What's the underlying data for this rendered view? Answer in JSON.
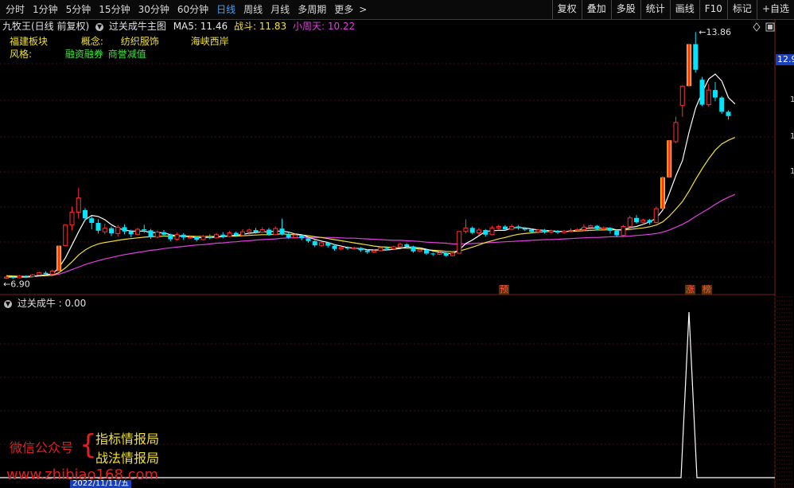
{
  "toolbar": {
    "periods": [
      "分时",
      "1分钟",
      "5分钟",
      "15分钟",
      "30分钟",
      "60分钟",
      "日线",
      "周线",
      "月线",
      "多周期",
      "更多"
    ],
    "active_period": "日线",
    "more_arrow": "chevron-right-icon",
    "tools": [
      "复权",
      "叠加",
      "多股",
      "统计",
      "画线",
      "F10",
      "标记",
      "+自选"
    ]
  },
  "header": {
    "stock": "九牧王(日线 前复权)",
    "indicator": "过关成牛主图",
    "ma5": "MA5: 11.46",
    "zhandou": "战斗: 11.83",
    "xiaozhoutian": "小周天: 10.22"
  },
  "info": {
    "sector": "福建板块",
    "concept_label": "概念:",
    "concept1": "纺织服饰",
    "concept2": "海峡西岸",
    "style_label": "风格:",
    "style1": "融资融券",
    "style2": "商誉减值"
  },
  "icons": {
    "top_diamond": "diamond-icon",
    "top_window": "window-icon"
  },
  "price_labels": {
    "high": "13.86",
    "low": "6.90",
    "side": "12.9"
  },
  "markers": {
    "yu": "预",
    "zhang": "涨",
    "bang": "榜"
  },
  "lower": {
    "title": "过关成牛 : 0.00"
  },
  "watermark": {
    "wechat": "微信公众号",
    "brace": "{",
    "line1": "指标情报局",
    "line2": "战法情报局",
    "url": "www.zhibiao168.com",
    "date_tag": "2022/11/11/五"
  },
  "colors": {
    "up": "#ff3030",
    "down": "#00e5ff",
    "limit_up": "#ffc000",
    "ma5": "#ffffff",
    "zhandou": "#f0e030",
    "xzt": "#e040e0",
    "active_tab": "#3fa3ff"
  },
  "chart_data": {
    "type": "candlestick",
    "price_range": [
      6.6,
      14.2
    ],
    "high": 13.86,
    "low": 6.9,
    "candles": [
      [
        6.95,
        6.98,
        7.02,
        6.92
      ],
      [
        6.98,
        6.96,
        7.0,
        6.93
      ],
      [
        6.96,
        7.01,
        7.04,
        6.94
      ],
      [
        7.01,
        6.99,
        7.03,
        6.96
      ],
      [
        6.99,
        7.04,
        7.07,
        6.97
      ],
      [
        7.04,
        7.1,
        7.13,
        7.02
      ],
      [
        7.1,
        7.06,
        7.14,
        7.03
      ],
      [
        7.06,
        7.15,
        7.19,
        7.04
      ],
      [
        7.15,
        7.86,
        7.86,
        7.15
      ],
      [
        7.86,
        8.44,
        8.46,
        7.84
      ],
      [
        8.44,
        8.8,
        8.96,
        8.3
      ],
      [
        8.8,
        9.2,
        9.48,
        8.62
      ],
      [
        8.86,
        8.63,
        8.92,
        8.55
      ],
      [
        8.63,
        8.5,
        8.7,
        8.32
      ],
      [
        8.5,
        8.28,
        8.6,
        8.2
      ],
      [
        8.25,
        8.35,
        8.48,
        8.18
      ],
      [
        8.35,
        8.21,
        8.4,
        8.13
      ],
      [
        8.2,
        8.38,
        8.44,
        8.12
      ],
      [
        8.38,
        8.26,
        8.46,
        8.18
      ],
      [
        8.26,
        8.18,
        8.31,
        8.1
      ],
      [
        8.18,
        8.32,
        8.36,
        8.15
      ],
      [
        8.32,
        8.29,
        8.45,
        8.22
      ],
      [
        8.29,
        8.1,
        8.33,
        8.05
      ],
      [
        8.1,
        8.24,
        8.29,
        8.07
      ],
      [
        8.24,
        8.17,
        8.3,
        8.12
      ],
      [
        8.17,
        8.04,
        8.2,
        7.98
      ],
      [
        8.04,
        8.17,
        8.22,
        8.0
      ],
      [
        8.17,
        8.09,
        8.21,
        8.02
      ],
      [
        8.09,
        8.1,
        8.15,
        8.05
      ],
      [
        8.1,
        8.03,
        8.13,
        7.98
      ],
      [
        8.03,
        8.12,
        8.16,
        8.01
      ],
      [
        8.12,
        8.08,
        8.18,
        8.04
      ],
      [
        8.08,
        8.17,
        8.22,
        8.06
      ],
      [
        8.17,
        8.12,
        8.24,
        8.07
      ],
      [
        8.12,
        8.22,
        8.27,
        8.1
      ],
      [
        8.22,
        8.15,
        8.26,
        8.11
      ],
      [
        8.15,
        8.25,
        8.32,
        8.12
      ],
      [
        8.25,
        8.3,
        8.34,
        8.17
      ],
      [
        8.3,
        8.24,
        8.36,
        8.2
      ],
      [
        8.24,
        8.31,
        8.38,
        8.22
      ],
      [
        8.31,
        8.17,
        8.36,
        8.14
      ],
      [
        8.17,
        8.34,
        8.4,
        8.15
      ],
      [
        8.34,
        8.18,
        8.62,
        8.15
      ],
      [
        8.18,
        8.09,
        8.22,
        8.05
      ],
      [
        8.09,
        8.16,
        8.2,
        8.06
      ],
      [
        8.16,
        8.07,
        8.18,
        8.01
      ],
      [
        8.07,
        7.99,
        8.1,
        7.94
      ],
      [
        7.99,
        7.87,
        8.02,
        7.82
      ],
      [
        7.87,
        7.94,
        7.98,
        7.83
      ],
      [
        7.94,
        7.86,
        7.97,
        7.81
      ],
      [
        7.86,
        7.77,
        7.9,
        7.72
      ],
      [
        7.77,
        7.81,
        7.85,
        7.73
      ],
      [
        7.81,
        7.78,
        7.84,
        7.74
      ],
      [
        7.78,
        7.8,
        7.83,
        7.75
      ],
      [
        7.8,
        7.73,
        7.82,
        7.68
      ],
      [
        7.73,
        7.68,
        7.76,
        7.63
      ],
      [
        7.68,
        7.72,
        7.75,
        7.65
      ],
      [
        7.72,
        7.8,
        7.83,
        7.7
      ],
      [
        7.8,
        7.77,
        7.84,
        7.73
      ],
      [
        7.77,
        7.83,
        7.86,
        7.75
      ],
      [
        7.83,
        7.9,
        7.95,
        7.8
      ],
      [
        7.9,
        7.84,
        7.93,
        7.8
      ],
      [
        7.84,
        7.7,
        7.86,
        7.66
      ],
      [
        7.7,
        7.74,
        7.77,
        7.68
      ],
      [
        7.74,
        7.64,
        7.76,
        7.6
      ],
      [
        7.64,
        7.62,
        7.67,
        7.58
      ],
      [
        7.62,
        7.66,
        7.69,
        7.6
      ],
      [
        7.66,
        7.58,
        7.68,
        7.55
      ],
      [
        7.58,
        7.65,
        7.68,
        7.56
      ],
      [
        7.65,
        8.26,
        8.26,
        7.64
      ],
      [
        8.26,
        8.36,
        8.6,
        8.2
      ],
      [
        8.36,
        8.22,
        8.4,
        8.18
      ],
      [
        8.22,
        8.3,
        8.36,
        8.15
      ],
      [
        8.3,
        8.17,
        8.33,
        8.12
      ],
      [
        8.17,
        8.36,
        8.42,
        8.15
      ],
      [
        8.36,
        8.4,
        8.45,
        8.3
      ],
      [
        8.4,
        8.32,
        8.44,
        8.28
      ],
      [
        8.32,
        8.4,
        8.46,
        8.3
      ],
      [
        8.4,
        8.35,
        8.44,
        8.31
      ],
      [
        8.35,
        8.31,
        8.38,
        8.27
      ],
      [
        8.31,
        8.25,
        8.34,
        8.2
      ],
      [
        8.25,
        8.3,
        8.33,
        8.21
      ],
      [
        8.3,
        8.24,
        8.33,
        8.2
      ],
      [
        8.24,
        8.28,
        8.31,
        8.21
      ],
      [
        8.28,
        8.23,
        8.3,
        8.19
      ],
      [
        8.23,
        8.27,
        8.3,
        8.2
      ],
      [
        8.27,
        8.29,
        8.34,
        8.24
      ],
      [
        8.29,
        8.31,
        8.35,
        8.26
      ],
      [
        8.31,
        8.38,
        8.46,
        8.27
      ],
      [
        8.38,
        8.42,
        8.45,
        8.32
      ],
      [
        8.42,
        8.33,
        8.44,
        8.3
      ],
      [
        8.33,
        8.36,
        8.4,
        8.3
      ],
      [
        8.36,
        8.28,
        8.38,
        8.2
      ],
      [
        8.28,
        8.15,
        8.3,
        8.1
      ],
      [
        8.15,
        8.4,
        8.44,
        8.13
      ],
      [
        8.4,
        8.64,
        8.7,
        8.38
      ],
      [
        8.64,
        8.52,
        8.72,
        8.48
      ],
      [
        8.52,
        8.58,
        8.62,
        8.46
      ],
      [
        8.58,
        8.51,
        8.61,
        8.45
      ],
      [
        8.51,
        8.9,
        8.96,
        8.49
      ],
      [
        8.9,
        9.78,
        9.8,
        8.88
      ],
      [
        9.78,
        10.82,
        10.82,
        9.78
      ],
      [
        10.78,
        11.32,
        11.48,
        10.74
      ],
      [
        11.8,
        12.34,
        12.36,
        11.48
      ],
      [
        12.34,
        13.52,
        13.52,
        12.34
      ],
      [
        13.52,
        12.8,
        13.86,
        12.72
      ],
      [
        12.52,
        11.82,
        12.6,
        11.78
      ],
      [
        11.82,
        12.23,
        12.4,
        11.76
      ],
      [
        12.23,
        12.02,
        12.46,
        11.92
      ],
      [
        12.02,
        11.62,
        12.06,
        11.56
      ],
      [
        11.62,
        11.5,
        11.66,
        11.4
      ]
    ],
    "ma5": [
      6.98,
      6.98,
      6.98,
      6.98,
      6.99,
      7.02,
      7.04,
      7.07,
      7.24,
      7.52,
      7.88,
      8.25,
      8.59,
      8.71,
      8.68,
      8.59,
      8.45,
      8.35,
      8.3,
      8.27,
      8.27,
      8.27,
      8.23,
      8.23,
      8.22,
      8.17,
      8.14,
      8.13,
      8.11,
      8.08,
      8.09,
      8.09,
      8.1,
      8.12,
      8.14,
      8.15,
      8.18,
      8.21,
      8.23,
      8.25,
      8.25,
      8.27,
      8.27,
      8.24,
      8.19,
      8.17,
      8.1,
      8.04,
      7.99,
      7.95,
      7.89,
      7.85,
      7.81,
      7.79,
      7.78,
      7.75,
      7.74,
      7.74,
      7.74,
      7.76,
      7.78,
      7.83,
      7.81,
      7.8,
      7.76,
      7.71,
      7.68,
      7.65,
      7.63,
      7.75,
      7.92,
      8.02,
      8.14,
      8.26,
      8.28,
      8.29,
      8.29,
      8.36,
      8.37,
      8.36,
      8.33,
      8.3,
      8.29,
      8.28,
      8.26,
      8.26,
      8.27,
      8.3,
      8.34,
      8.35,
      8.36,
      8.35,
      8.35,
      8.3,
      8.31,
      8.37,
      8.4,
      8.46,
      8.53,
      8.63,
      8.86,
      9.33,
      9.82,
      10.25,
      11.04,
      11.72,
      12.16,
      12.54,
      12.68,
      12.48,
      12.02,
      11.84
    ],
    "zhandou": [
      7.02,
      7.01,
      7.0,
      7.0,
      7.0,
      7.01,
      7.02,
      7.03,
      7.1,
      7.24,
      7.41,
      7.6,
      7.74,
      7.84,
      7.91,
      7.95,
      7.98,
      8.01,
      8.04,
      8.06,
      8.08,
      8.1,
      8.11,
      8.12,
      8.13,
      8.13,
      8.13,
      8.13,
      8.13,
      8.12,
      8.12,
      8.12,
      8.12,
      8.12,
      8.13,
      8.13,
      8.14,
      8.15,
      8.16,
      8.17,
      8.17,
      8.18,
      8.19,
      8.18,
      8.17,
      8.16,
      8.14,
      8.11,
      8.09,
      8.06,
      8.03,
      8.0,
      7.97,
      7.94,
      7.91,
      7.88,
      7.85,
      7.83,
      7.82,
      7.8,
      7.8,
      7.79,
      7.78,
      7.77,
      7.75,
      7.73,
      7.72,
      7.7,
      7.69,
      7.71,
      7.76,
      7.82,
      7.88,
      7.95,
      8.0,
      8.05,
      8.09,
      8.14,
      8.18,
      8.2,
      8.22,
      8.24,
      8.25,
      8.26,
      8.26,
      8.26,
      8.26,
      8.27,
      8.28,
      8.29,
      8.3,
      8.3,
      8.31,
      8.3,
      8.3,
      8.32,
      8.34,
      8.36,
      8.39,
      8.44,
      8.53,
      8.69,
      8.89,
      9.1,
      9.39,
      9.72,
      10.02,
      10.3,
      10.54,
      10.72,
      10.82,
      10.9
    ],
    "xzt": [
      7.0,
      7.0,
      7.0,
      7.0,
      7.01,
      7.02,
      7.02,
      7.03,
      7.06,
      7.12,
      7.19,
      7.26,
      7.33,
      7.39,
      7.44,
      7.49,
      7.53,
      7.57,
      7.61,
      7.64,
      7.67,
      7.7,
      7.73,
      7.75,
      7.78,
      7.8,
      7.82,
      7.84,
      7.86,
      7.88,
      7.89,
      7.91,
      7.93,
      7.94,
      7.96,
      7.97,
      7.99,
      8.0,
      8.02,
      8.03,
      8.04,
      8.05,
      8.07,
      8.08,
      8.08,
      8.09,
      8.09,
      8.09,
      8.09,
      8.09,
      8.09,
      8.08,
      8.07,
      8.07,
      8.06,
      8.05,
      8.04,
      8.03,
      8.02,
      8.01,
      8.01,
      8.0,
      7.99,
      7.98,
      7.96,
      7.95,
      7.94,
      7.93,
      7.91,
      7.91,
      7.91,
      7.92,
      7.93,
      7.94,
      7.95,
      7.96,
      7.97,
      7.98,
      7.99,
      8.0,
      8.01,
      8.02,
      8.03,
      8.03,
      8.04,
      8.05,
      8.06,
      8.07,
      8.08,
      8.09,
      8.09,
      8.1,
      8.11,
      8.11,
      8.12,
      8.13,
      8.15,
      8.16,
      8.18,
      8.2,
      8.24,
      8.3,
      8.38,
      8.46,
      8.56,
      8.68,
      8.79,
      8.9,
      9.02,
      9.13,
      9.22,
      9.3
    ],
    "signal_index": 104,
    "signal_range": [
      0,
      1
    ]
  }
}
